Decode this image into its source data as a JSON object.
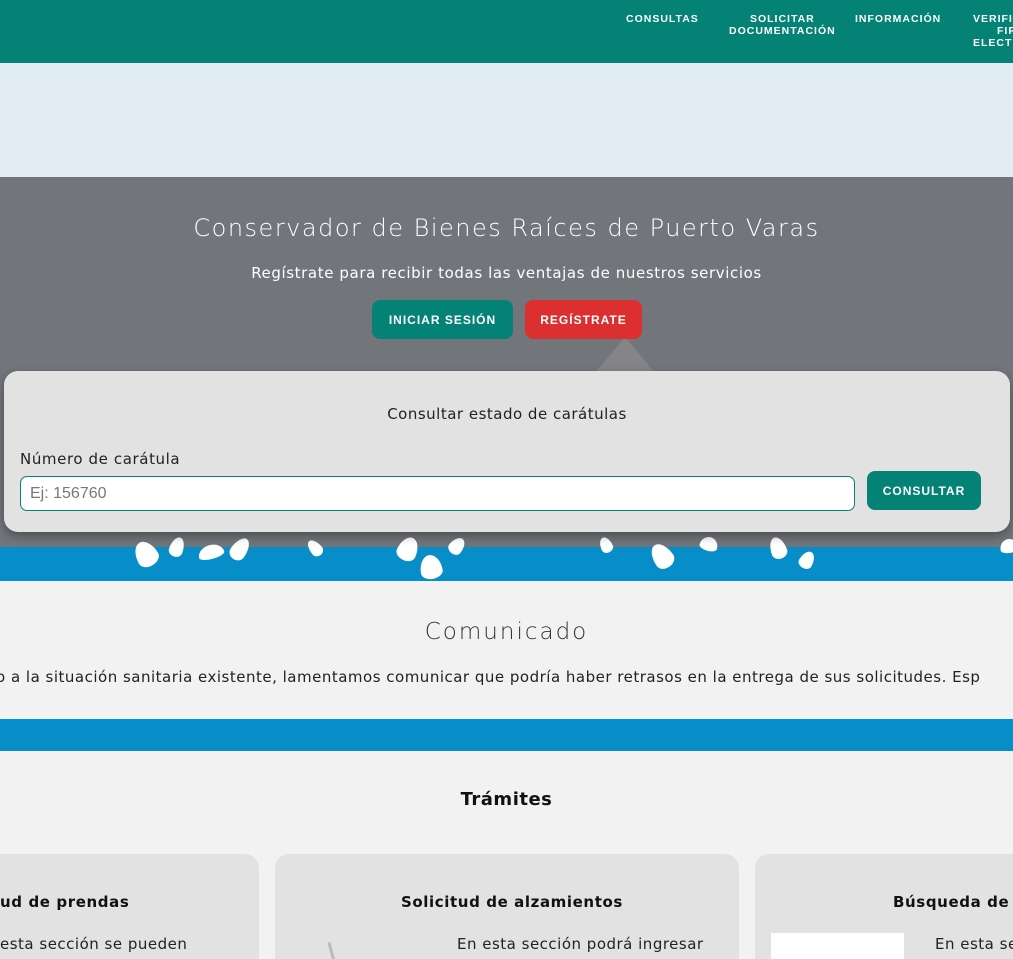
{
  "nav": {
    "consultas": "CONSULTAS",
    "solicitar_line1": "SOLICITAR",
    "solicitar_line2": "DOCUMENTACIÓN",
    "informacion": "INFORMACIÓN",
    "verificar_line1": "VERIFI",
    "verificar_line2": "FIR",
    "verificar_line3": "ELECT"
  },
  "hero": {
    "title": "Conservador de Bienes Raíces de Puerto Varas",
    "subtitle": "Regístrate para recibir todas las ventajas de nuestros servicios",
    "login_label": "INICIAR SESIÓN",
    "register_label": "REGÍSTRATE"
  },
  "search": {
    "title": "Consultar estado de carátulas",
    "label": "Número de carátula",
    "placeholder": "Ej: 156760",
    "button_label": "CONSULTAR"
  },
  "comunicado": {
    "title": "Comunicado",
    "text": "do a la situación sanitaria existente, lamentamos comunicar que podría haber retrasos en la entrega de sus solicitudes. Esp"
  },
  "tramites": {
    "title": "Trámites",
    "cards": [
      {
        "title": "ud de prendas",
        "text": "esta sección se pueden"
      },
      {
        "title": "Solicitud de alzamientos",
        "text": "En esta sección podrá ingresar"
      },
      {
        "title": "Búsqueda de c",
        "text": "En esta se"
      }
    ]
  },
  "colors": {
    "primary": "#048275",
    "danger": "#dc3030",
    "accent_blue": "#078dc8",
    "hero_gray": "#72767b"
  }
}
